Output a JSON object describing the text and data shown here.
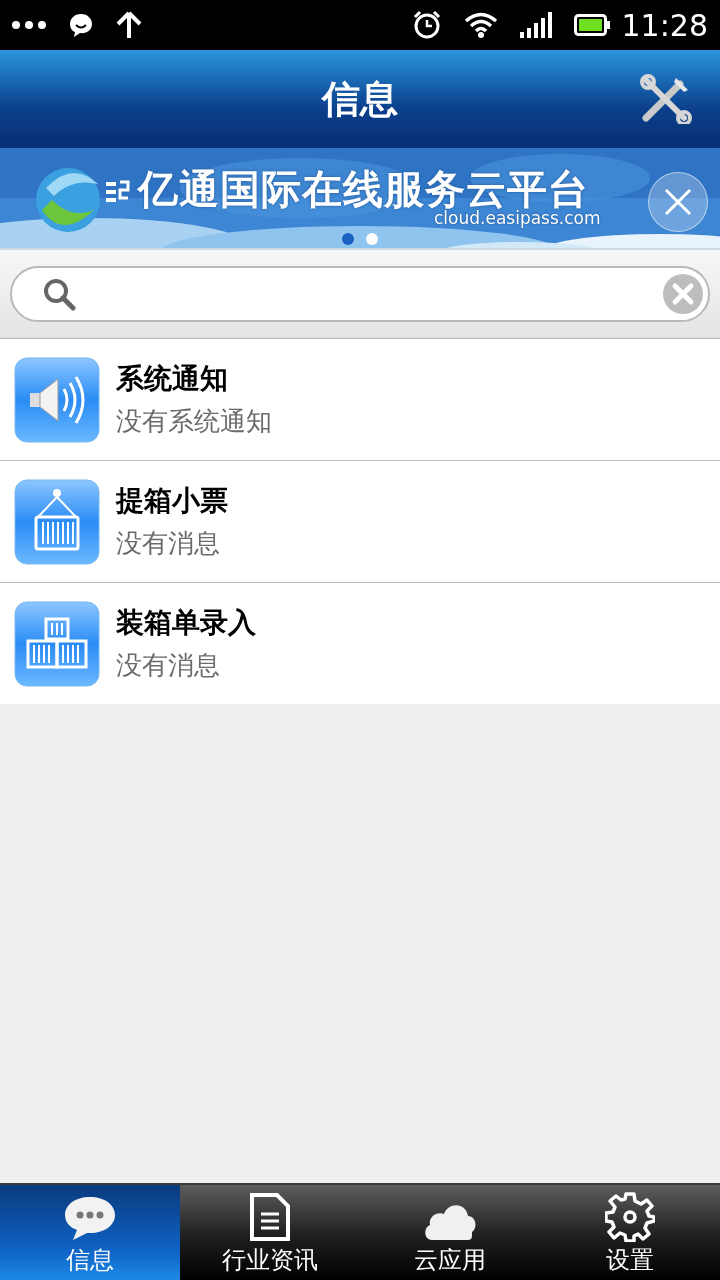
{
  "status_bar": {
    "time": "11:28"
  },
  "header": {
    "title": "信息"
  },
  "banner": {
    "title": "亿通国际在线服务云平台",
    "url": "cloud.easipass.com",
    "pages": [
      {
        "selected": true
      },
      {
        "selected": false
      }
    ]
  },
  "items": [
    {
      "kind": "speaker",
      "title": "系统通知",
      "subtitle": "没有系统通知"
    },
    {
      "kind": "container",
      "title": "提箱小票",
      "subtitle": "没有消息"
    },
    {
      "kind": "stack",
      "title": "装箱单录入",
      "subtitle": "没有消息"
    }
  ],
  "tabs": [
    {
      "kind": "chat",
      "label": "信息",
      "selected": true
    },
    {
      "kind": "document",
      "label": "行业资讯",
      "selected": false
    },
    {
      "kind": "cloud",
      "label": "云应用",
      "selected": false
    },
    {
      "kind": "gear",
      "label": "设置",
      "selected": false
    }
  ]
}
